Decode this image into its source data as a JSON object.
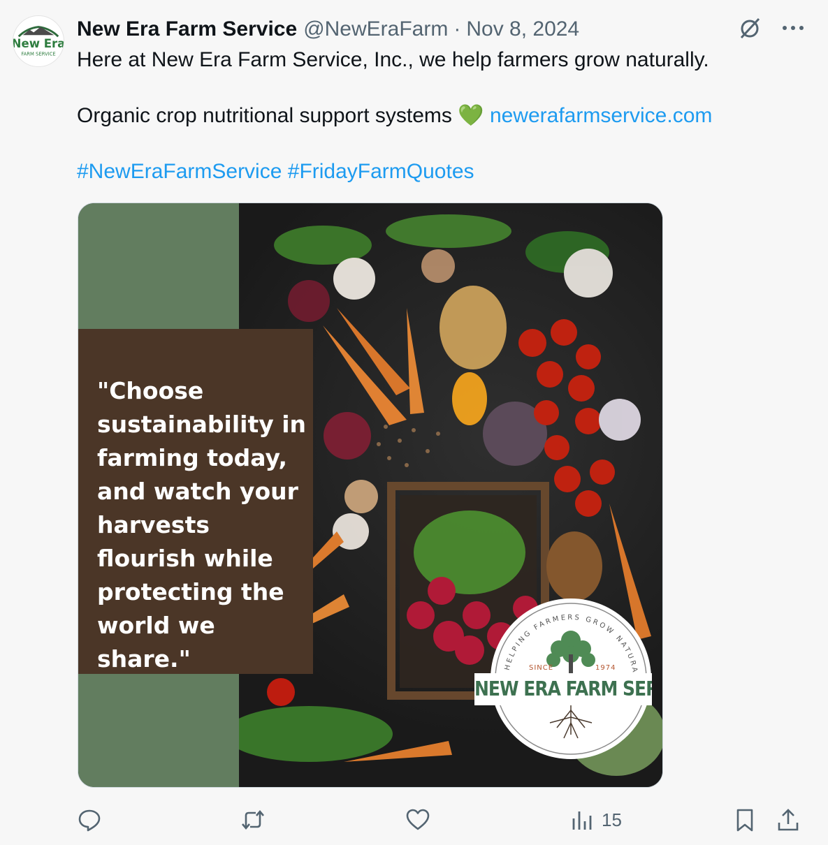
{
  "account": {
    "name": "New Era Farm Service",
    "handle": "@NewEraFarm",
    "separator": "·",
    "date": "Nov 8, 2024",
    "avatar_text_top": "New Era",
    "avatar_text_bottom": "FARM SERVICE"
  },
  "post": {
    "line1": "Here at New Era Farm Service, Inc., we help farmers grow naturally.",
    "line2_text": "Organic crop nutritional support systems ",
    "line2_emoji": "💚",
    "line2_link": "newerafarmservice.com",
    "hashtag1": "#NewEraFarmService",
    "hashtag2": "#FridayFarmQuotes"
  },
  "media": {
    "quote": "\"Choose sustainability in farming today, and watch your harvests flourish while protecting the world we share.\"",
    "badge_arc_text": "HELPING FARMERS GROW NATURALLY",
    "badge_since": "SINCE",
    "badge_year": "1974",
    "badge_title": "NEW ERA FARM SERVICE"
  },
  "actions": {
    "views_count": "15"
  },
  "icons": {
    "grok": "grok-icon",
    "more": "more-icon",
    "reply": "reply-icon",
    "repost": "repost-icon",
    "like": "heart-icon",
    "views": "views-icon",
    "bookmark": "bookmark-icon",
    "share": "share-icon"
  },
  "colors": {
    "link": "#1d9bf0",
    "muted": "#536471",
    "green_band": "#627d5f",
    "quote_box": "#4b3627",
    "brand_green": "#3d7150"
  }
}
